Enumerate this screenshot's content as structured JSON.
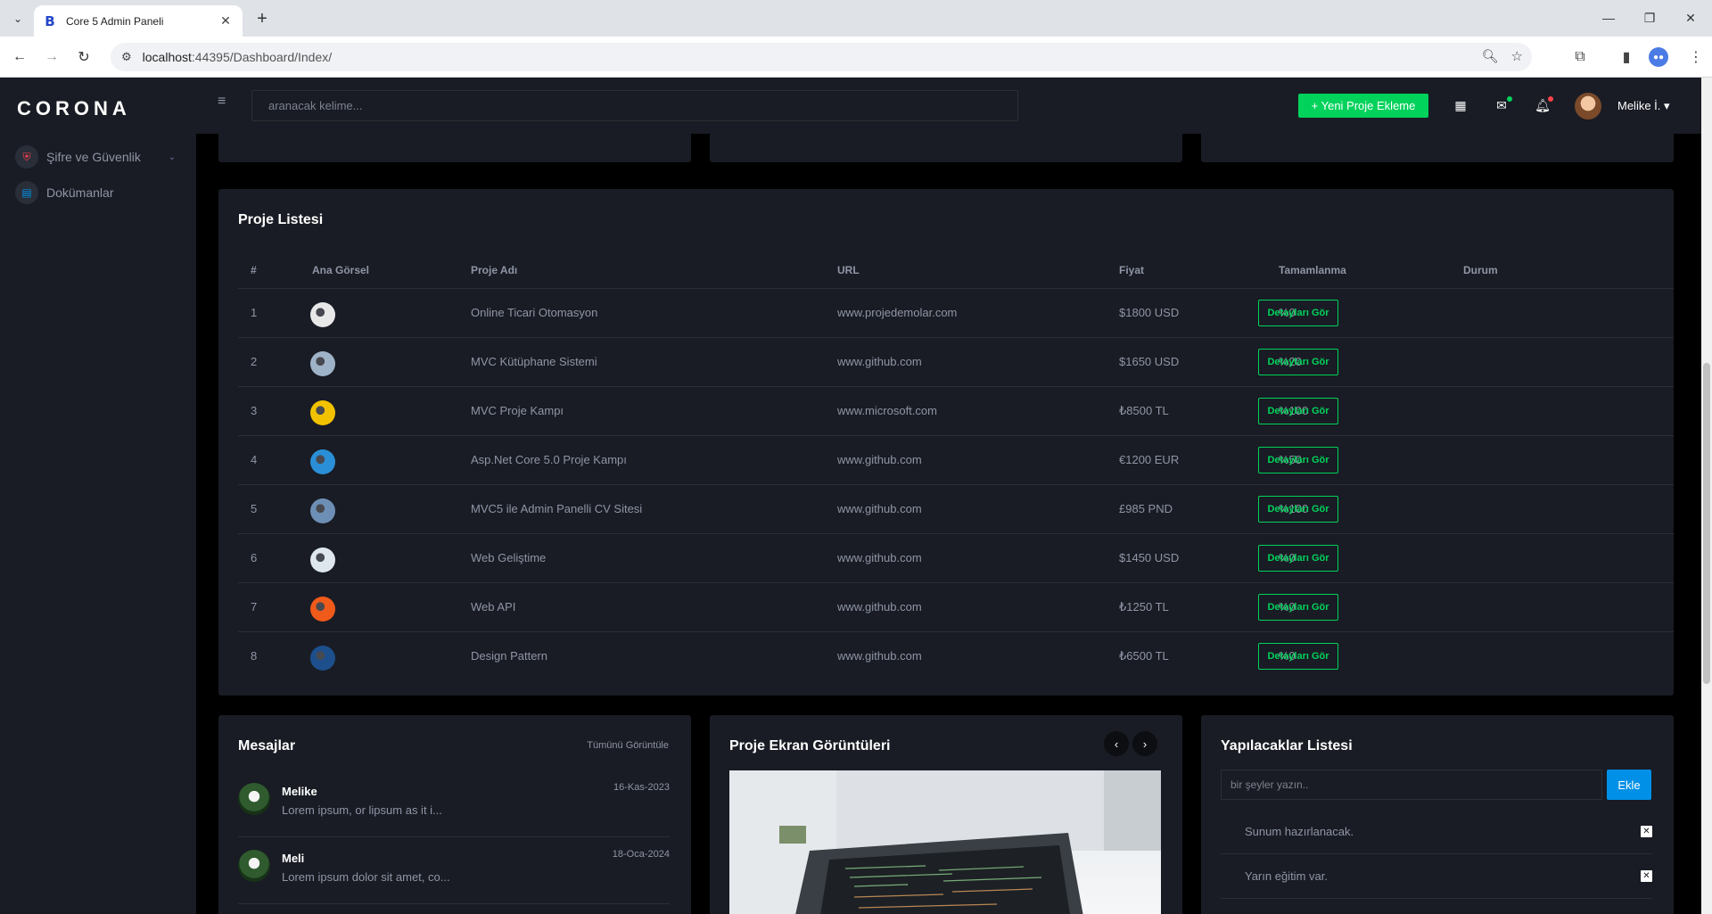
{
  "browser": {
    "tab_title": "Core 5 Admin Paneli",
    "url_host": "localhost",
    "url_rest": ":44395/Dashboard/Index/"
  },
  "sidebar": {
    "brand": "CORONA",
    "items": [
      {
        "label": "Şifre ve Güvenlik",
        "icon": "shield-icon",
        "color": "#fc424a"
      },
      {
        "label": "Dokümanlar",
        "icon": "document-icon",
        "color": "#0090e7"
      }
    ]
  },
  "topbar": {
    "search_placeholder": "aranacak kelime...",
    "new_project_label": "+ Yeni Proje Ekleme",
    "user_name": "Melike İ."
  },
  "projects": {
    "title": "Proje Listesi",
    "headers": [
      "#",
      "Ana Görsel",
      "Proje Adı",
      "URL",
      "Fiyat",
      "Tamamlanma",
      "Durum"
    ],
    "detail_label": "Detayları Gör",
    "rows": [
      {
        "no": "1",
        "name": "Online Ticari Otomasyon",
        "url": "www.projedemolar.com",
        "price": "$1800 USD",
        "progress": "%0",
        "thumb": "#e8e8e8"
      },
      {
        "no": "2",
        "name": "MVC Kütüphane Sistemi",
        "url": "www.github.com",
        "price": "$1650 USD",
        "progress": "%20",
        "thumb": "#9fb3c8"
      },
      {
        "no": "3",
        "name": "MVC Proje Kampı",
        "url": "www.microsoft.com",
        "price": "₺8500 TL",
        "progress": "%100",
        "thumb": "#f2c200"
      },
      {
        "no": "4",
        "name": "Asp.Net Core 5.0 Proje Kampı",
        "url": "www.github.com",
        "price": "€1200 EUR",
        "progress": "%50",
        "thumb": "#2a8fd6"
      },
      {
        "no": "5",
        "name": "MVC5 ile Admin Panelli CV Sitesi",
        "url": "www.github.com",
        "price": "£985 PND",
        "progress": "%100",
        "thumb": "#6d8fb5"
      },
      {
        "no": "6",
        "name": "Web Geliştime",
        "url": "www.github.com",
        "price": "$1450 USD",
        "progress": "%0",
        "thumb": "#dfe7ee"
      },
      {
        "no": "7",
        "name": "Web API",
        "url": "www.github.com",
        "price": "₺1250 TL",
        "progress": "%0",
        "thumb": "#f05a1a"
      },
      {
        "no": "8",
        "name": "Design Pattern",
        "url": "www.github.com",
        "price": "₺6500 TL",
        "progress": "%0",
        "thumb": "#1d4f8c"
      }
    ]
  },
  "messages": {
    "title": "Mesajlar",
    "view_all": "Tümünü Görüntüle",
    "items": [
      {
        "name": "Melike",
        "text": "Lorem ipsum, or lipsum as it i...",
        "date": "16-Kas-2023"
      },
      {
        "name": "Meli",
        "text": "Lorem ipsum dolor sit amet, co...",
        "date": "18-Oca-2024"
      }
    ]
  },
  "screens": {
    "title": "Proje Ekran Görüntüleri"
  },
  "todo": {
    "title": "Yapılacaklar Listesi",
    "placeholder": "bir şeyler yazın..",
    "add_label": "Ekle",
    "items": [
      "Sunum hazırlanacak.",
      "Yarın eğitim var."
    ]
  }
}
